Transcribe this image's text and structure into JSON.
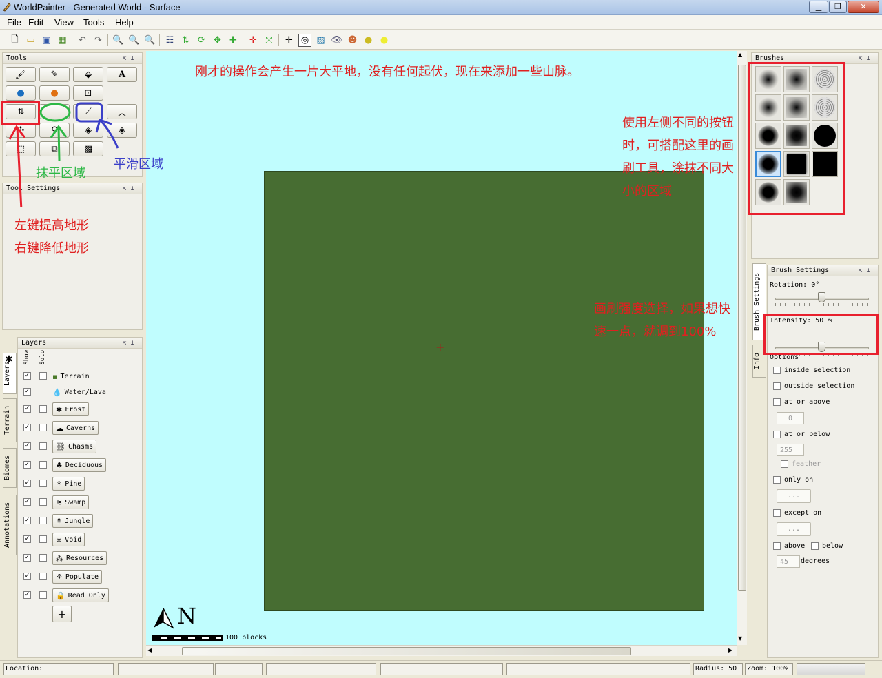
{
  "window": {
    "title": "WorldPainter - Generated World - Surface"
  },
  "menu": [
    "File",
    "Edit",
    "View",
    "Tools",
    "Help"
  ],
  "panels": {
    "tools": "Tools",
    "tool_settings": "Tool Settings",
    "layers": "Layers",
    "brushes": "Brushes",
    "brush_settings": "Brush Settings"
  },
  "layers": {
    "col_show": "Show",
    "col_solo": "Solo",
    "items": [
      "Terrain",
      "Water/Lava",
      "Frost",
      "Caverns",
      "Chasms",
      "Deciduous",
      "Pine",
      "Swamp",
      "Jungle",
      "Void",
      "Resources",
      "Populate",
      "Read Only"
    ],
    "add_label": "+"
  },
  "side_tabs": {
    "layers": "Layers",
    "terrain": "Terrain",
    "biomes": "Biomes",
    "annotations": "Annotations",
    "brush_settings": "Brush Settings",
    "info": "Info"
  },
  "canvas": {
    "scale_label": "100 blocks",
    "north": "N"
  },
  "brush_settings": {
    "rotation": "Rotation: 0°",
    "rotation_level": 0.5,
    "intensity": "Intensity: 50 %",
    "intensity_level": 0.5,
    "options_title": "Options",
    "inside_selection": "inside selection",
    "outside_selection": "outside selection",
    "at_or_above": "at or above",
    "at_or_above_value": "0",
    "at_or_below": "at or below",
    "at_or_below_value": "255",
    "feather": "feather",
    "only_on": "only on",
    "except_on": "except on",
    "dots": "...",
    "above": "above",
    "below": "below",
    "degrees_value": "45",
    "degrees": "degrees"
  },
  "status": {
    "location": "Location:",
    "radius": "Radius: 50",
    "zoom": "Zoom: 100%"
  },
  "annotations": {
    "top": "刚才的操作会产生一片大平地，没有任何起伏，现在来添加一些山脉。",
    "brushes_note": [
      "使用左侧不同的按钮",
      "时，可搭配这里的画",
      "刷工具，涂抹不同大",
      "小的区域"
    ],
    "flatten": "抹平区域",
    "smooth": "平滑区域",
    "raise_lower": [
      "左键提高地形",
      "右键降低地形"
    ],
    "intensity_note": [
      "画刷强度选择，如果想快",
      "速一点，就调到100%"
    ]
  },
  "colors": {
    "canvas_bg": "#c0fdfe",
    "land": "#476d32",
    "annotation_red": "#e8202e",
    "annotation_green": "#2db845",
    "annotation_blue": "#3b40c8"
  }
}
